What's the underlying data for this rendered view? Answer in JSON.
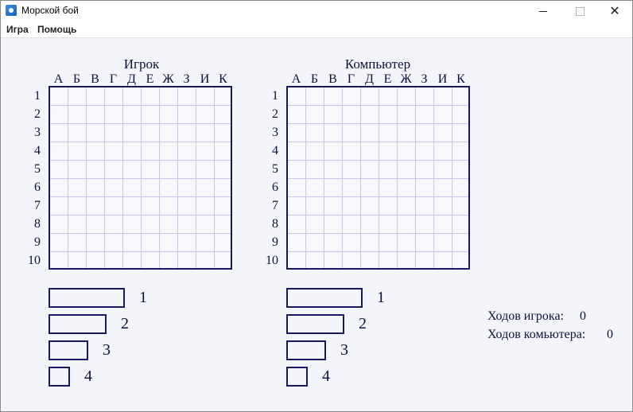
{
  "window": {
    "title": "Морской бой",
    "icon": "battleship-app-icon",
    "controls": {
      "minimize": "minimize-icon",
      "maximize": "maximize-icon",
      "close": "close-icon"
    }
  },
  "menu": {
    "game": "Игра",
    "help": "Помощь"
  },
  "boards": {
    "player": {
      "title": "Игрок"
    },
    "computer": {
      "title": "Компьютер"
    },
    "columns": [
      "А",
      "Б",
      "В",
      "Г",
      "Д",
      "Е",
      "Ж",
      "З",
      "И",
      "К"
    ],
    "rows": [
      "1",
      "2",
      "3",
      "4",
      "5",
      "6",
      "7",
      "8",
      "9",
      "10"
    ]
  },
  "fleet": {
    "player": [
      {
        "length": 4,
        "count": "1"
      },
      {
        "length": 3,
        "count": "2"
      },
      {
        "length": 2,
        "count": "3"
      },
      {
        "length": 1,
        "count": "4"
      }
    ],
    "computer": [
      {
        "length": 4,
        "count": "1"
      },
      {
        "length": 3,
        "count": "2"
      },
      {
        "length": 2,
        "count": "3"
      },
      {
        "length": 1,
        "count": "4"
      }
    ]
  },
  "stats": {
    "player_moves_label": "Ходов игрока:",
    "player_moves": "0",
    "computer_moves_label": "Ходов комьютера:",
    "computer_moves": "0"
  },
  "colors": {
    "grid_border": "#171763",
    "grid_lines": "#c9c9ee",
    "background": "#f4f5fa"
  }
}
